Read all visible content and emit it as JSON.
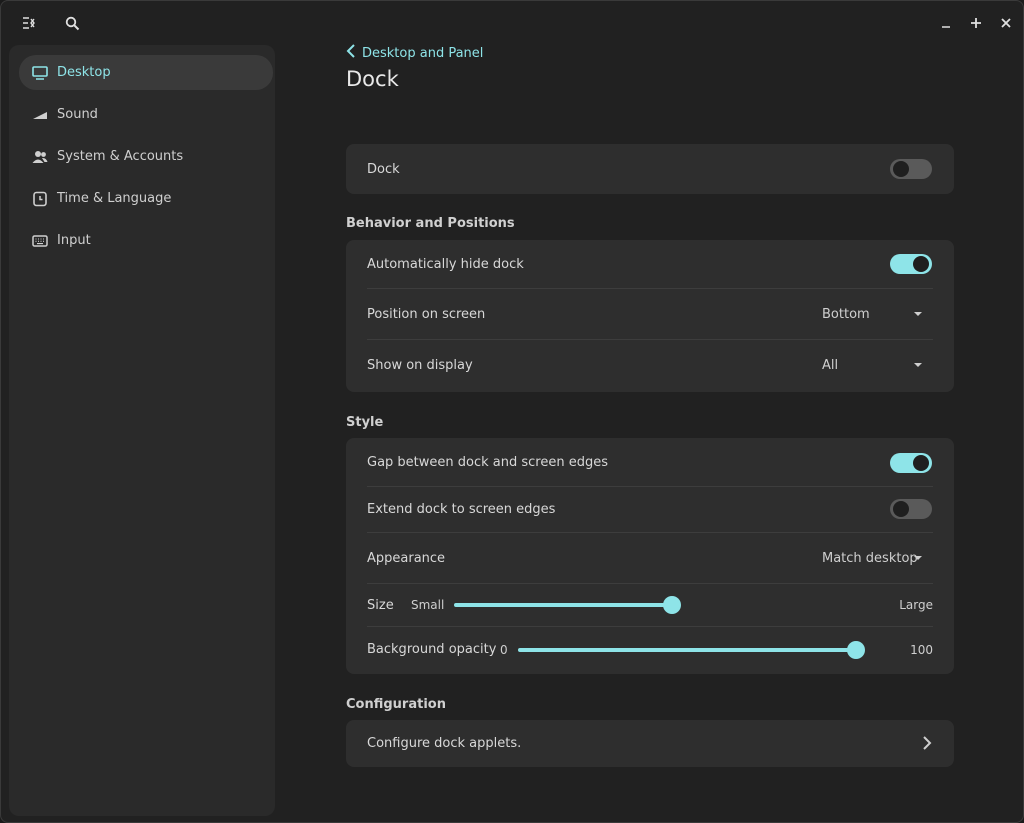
{
  "titlebar": {
    "menu_icon": "sidebar-toggle-icon",
    "search_icon": "search-icon",
    "minimize_icon": "minimize-icon",
    "maximize_icon": "maximize-icon",
    "close_icon": "close-icon"
  },
  "sidebar": {
    "items": [
      {
        "label": "Desktop",
        "icon": "monitor-icon",
        "active": true
      },
      {
        "label": "Sound",
        "icon": "sound-icon",
        "active": false
      },
      {
        "label": "System & Accounts",
        "icon": "users-icon",
        "active": false
      },
      {
        "label": "Time & Language",
        "icon": "clock-icon",
        "active": false
      },
      {
        "label": "Input",
        "icon": "keyboard-icon",
        "active": false
      }
    ]
  },
  "header": {
    "back_label": "Desktop and Panel",
    "title": "Dock"
  },
  "dock_card": {
    "label": "Dock",
    "enabled": false
  },
  "behavior": {
    "heading": "Behavior and Positions",
    "auto_hide_label": "Automatically hide dock",
    "auto_hide": true,
    "position_label": "Position on screen",
    "position_value": "Bottom",
    "display_label": "Show on display",
    "display_value": "All"
  },
  "style": {
    "heading": "Style",
    "gap_label": "Gap between dock and screen edges",
    "gap": true,
    "extend_label": "Extend dock to screen edges",
    "extend": false,
    "appearance_label": "Appearance",
    "appearance_value": "Match desktop",
    "size_label": "Size",
    "size_min_label": "Small",
    "size_max_label": "Large",
    "size_value": 1.0,
    "opacity_label": "Background opacity",
    "opacity_min_label": "0",
    "opacity_max_label": "100",
    "opacity_value": 1.0
  },
  "configuration": {
    "heading": "Configuration",
    "applets_label": "Configure dock applets."
  },
  "colors": {
    "accent": "#8ee4e8",
    "background": "#212121",
    "card": "#2e2e2e",
    "sidebar": "#2a2a2a"
  }
}
